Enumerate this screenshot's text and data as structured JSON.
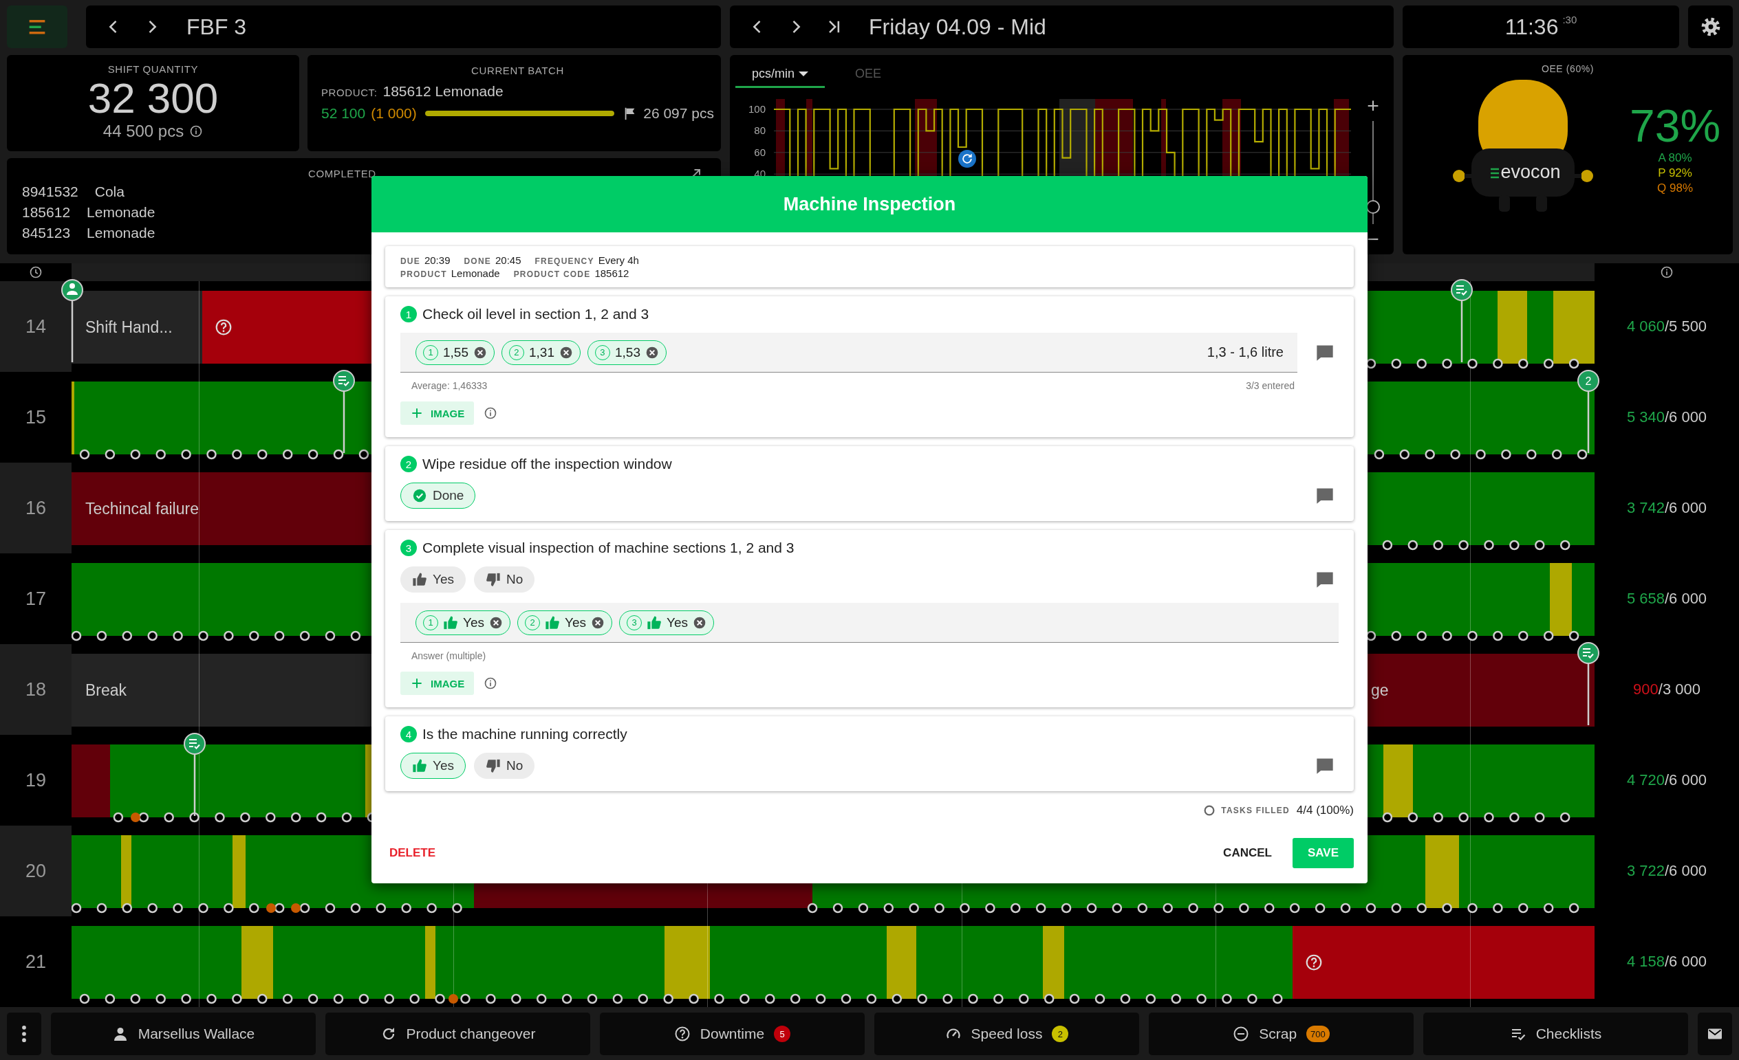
{
  "toolbar": {
    "title": "FBF 3"
  },
  "period": {
    "title": "Friday 04.09 - Mid"
  },
  "clock": {
    "time": "11:36",
    "seconds": ":30"
  },
  "shift_quantity": {
    "label": "SHIFT QUANTITY",
    "value": "32 300",
    "target": "44 500 pcs"
  },
  "current_batch": {
    "label": "CURRENT BATCH",
    "product_label": "PRODUCT:",
    "product": "185612 Lemonade",
    "produced": "52 100",
    "scrap": "(1 000)",
    "level": 1,
    "remaining": "26 097 pcs"
  },
  "completed": {
    "label": "COMPLETED",
    "items": [
      {
        "code": "8941532",
        "name": "Cola"
      },
      {
        "code": "185612",
        "name": "Lemonade"
      },
      {
        "code": "845123",
        "name": "Lemonade"
      }
    ]
  },
  "speed_chart": {
    "tabs": [
      {
        "label": "pcs/min",
        "selected": true
      },
      {
        "label": "OEE",
        "selected": false
      }
    ],
    "zoom": {
      "zoom_in": "+",
      "zoom_out": "−",
      "level": 0.1
    },
    "axis_labels": [
      "100",
      "80",
      "60",
      "40"
    ]
  },
  "oee": {
    "label": "OEE (60%)",
    "mascot_label": "evocon",
    "value": "73%",
    "factors": [
      {
        "text": "A 80%",
        "color": "#1fa64a"
      },
      {
        "text": "P 92%",
        "color": "#c8c000"
      },
      {
        "text": "Q 98%",
        "color": "#d97a00"
      }
    ]
  },
  "timeline": {
    "rows": [
      {
        "hour": "14",
        "done": "4 060",
        "target": "/5 500",
        "color": "#1fa64a",
        "labels": [
          "Shift Hand..."
        ],
        "pins": [
          {
            "kind": "operator"
          },
          {
            "kind": "checklist"
          }
        ]
      },
      {
        "hour": "15",
        "done": "5 340",
        "target": "/6 000",
        "color": "#1fa64a",
        "pins": [
          {
            "kind": "checklist"
          },
          {
            "kind": "count",
            "count": "2"
          }
        ]
      },
      {
        "hour": "16",
        "done": "3 742",
        "target": "/6 000",
        "color": "#1fa64a",
        "labels": [
          "Techincal failure"
        ]
      },
      {
        "hour": "17",
        "done": "5 658",
        "target": "/6 000",
        "color": "#1fa64a"
      },
      {
        "hour": "18",
        "done": "900",
        "target": "/3 000",
        "color": "#d0101a",
        "labels": [
          "Break",
          "ge"
        ],
        "pins": [
          {
            "kind": "checklist"
          }
        ]
      },
      {
        "hour": "19",
        "done": "4 720",
        "target": "/6 000",
        "color": "#1fa64a",
        "pins": [
          {
            "kind": "checklist"
          }
        ]
      },
      {
        "hour": "20",
        "done": "3 722",
        "target": "/6 000",
        "color": "#1fa64a"
      },
      {
        "hour": "21",
        "done": "4 158",
        "target": "/6 000",
        "color": "#1fa64a"
      }
    ]
  },
  "inspection": {
    "title": "Machine Inspection",
    "info_rows": [
      [
        {
          "label": "DUE",
          "value": "20:39"
        },
        {
          "label": "DONE",
          "value": "20:45"
        },
        {
          "label": "FREQUENCY",
          "value": "Every 4h"
        }
      ],
      [
        {
          "label": "PRODUCT",
          "value": "Lemonade"
        },
        {
          "label": "PRODUCT CODE",
          "value": "185612"
        }
      ]
    ],
    "tasks": [
      {
        "kind": "measure",
        "number": "1",
        "title": "Check oil level in section 1, 2 and 3",
        "answers": [
          {
            "index": "1",
            "value": "1,55"
          },
          {
            "index": "2",
            "value": "1,31"
          },
          {
            "index": "3",
            "value": "1,53"
          }
        ],
        "range": "1,3 - 1,6 litre",
        "helper": "Average: 1,46333",
        "count": "3/3 entered",
        "image_button": "IMAGE"
      },
      {
        "kind": "done",
        "number": "2",
        "title": "Wipe residue off the inspection window",
        "done_label": "Done",
        "checked": true
      },
      {
        "kind": "yesno_multi",
        "number": "3",
        "title": "Complete visual inspection of machine sections 1, 2 and 3",
        "options": [
          {
            "label": "Yes",
            "selected": false
          },
          {
            "label": "No",
            "selected": false
          }
        ],
        "answers": [
          {
            "index": "1",
            "value": "Yes"
          },
          {
            "index": "2",
            "value": "Yes"
          },
          {
            "index": "3",
            "value": "Yes"
          }
        ],
        "helper": "Answer (multiple)",
        "image_button": "IMAGE"
      },
      {
        "kind": "yesno",
        "number": "4",
        "title": "Is the machine running correctly",
        "options": [
          {
            "label": "Yes",
            "selected": true
          },
          {
            "label": "No",
            "selected": false
          }
        ]
      }
    ],
    "progress_label": "TASKS FILLED",
    "progress": "4/4 (100%)",
    "delete": "DELETE",
    "cancel": "CANCEL",
    "save": "SAVE"
  },
  "actions": [
    {
      "kind": "operator",
      "label": "Marsellus Wallace"
    },
    {
      "kind": "changeover",
      "label": "Product changeover"
    },
    {
      "kind": "downtime",
      "label": "Downtime",
      "badge": "5",
      "color": "#c0000a"
    },
    {
      "kind": "speed",
      "label": "Speed loss",
      "badge": "2",
      "color": "#c8c000"
    },
    {
      "kind": "scrap",
      "label": "Scrap",
      "badge": "700",
      "color": "#d97a00"
    },
    {
      "kind": "checklists",
      "label": "Checklists"
    }
  ]
}
